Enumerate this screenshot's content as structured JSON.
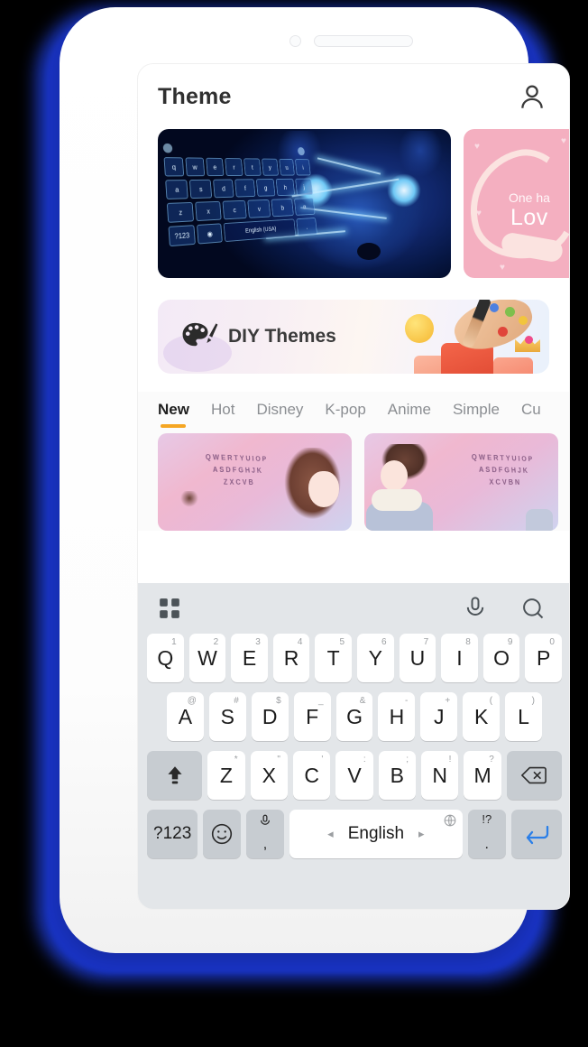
{
  "app": {
    "title": "Theme",
    "account_icon": "person-icon"
  },
  "featured": [
    {
      "name": "blue-wolf-theme",
      "keyboard_rows": [
        [
          "q",
          "w",
          "e",
          "r",
          "t",
          "y",
          "u",
          "i"
        ],
        [
          "a",
          "s",
          "d",
          "f",
          "g",
          "h",
          "j"
        ],
        [
          "z",
          "x",
          "c",
          "v",
          "b",
          "n"
        ]
      ],
      "space_label": "English (USA)",
      "num_label": "?123"
    },
    {
      "name": "one-hand-love-theme",
      "line1": "One ha",
      "line2": "Lov"
    }
  ],
  "diy_banner": {
    "label": "DIY Themes",
    "icon": "palette-brush-icon"
  },
  "tabs": [
    {
      "label": "New",
      "active": true
    },
    {
      "label": "Hot",
      "active": false
    },
    {
      "label": "Disney",
      "active": false
    },
    {
      "label": "K-pop",
      "active": false
    },
    {
      "label": "Anime",
      "active": false
    },
    {
      "label": "Simple",
      "active": false
    },
    {
      "label": "Cu",
      "active": false
    }
  ],
  "theme_grid": [
    {
      "name": "sakura-girl-theme",
      "rows": [
        "Q W E R T Y U I O P",
        "A S D F G H J K",
        "Z X C V B"
      ]
    },
    {
      "name": "sakura-boy-theme",
      "rows": [
        "Q W E R T Y U I O P",
        "A S D F G H J K",
        "X C V B N"
      ]
    }
  ],
  "keyboard": {
    "toolbar": {
      "grid_icon": "grid-icon",
      "mic_icon": "microphone-icon",
      "search_icon": "search-icon"
    },
    "row1": [
      {
        "key": "Q",
        "sup": "1"
      },
      {
        "key": "W",
        "sup": "2"
      },
      {
        "key": "E",
        "sup": "3"
      },
      {
        "key": "R",
        "sup": "4"
      },
      {
        "key": "T",
        "sup": "5"
      },
      {
        "key": "Y",
        "sup": "6"
      },
      {
        "key": "U",
        "sup": "7"
      },
      {
        "key": "I",
        "sup": "8"
      },
      {
        "key": "O",
        "sup": "9"
      },
      {
        "key": "P",
        "sup": "0"
      }
    ],
    "row2": [
      {
        "key": "A",
        "sup": "@"
      },
      {
        "key": "S",
        "sup": "#"
      },
      {
        "key": "D",
        "sup": "$"
      },
      {
        "key": "F",
        "sup": "_"
      },
      {
        "key": "G",
        "sup": "&"
      },
      {
        "key": "H",
        "sup": "-"
      },
      {
        "key": "J",
        "sup": "+"
      },
      {
        "key": "K",
        "sup": "("
      },
      {
        "key": "L",
        "sup": ")"
      }
    ],
    "row3": [
      {
        "key": "Z",
        "sup": "*"
      },
      {
        "key": "X",
        "sup": "\""
      },
      {
        "key": "C",
        "sup": "'"
      },
      {
        "key": "V",
        "sup": ":"
      },
      {
        "key": "B",
        "sup": ";"
      },
      {
        "key": "N",
        "sup": "!"
      },
      {
        "key": "M",
        "sup": "?"
      }
    ],
    "shift_icon": "shift-up-icon",
    "backspace_icon": "backspace-icon",
    "row4": {
      "num_label": "?123",
      "emoji_icon": "smiley-icon",
      "comma_key": ",",
      "comma_mic_icon": "microphone-icon",
      "space_label": "English",
      "space_left_arrow": "◂",
      "space_right_arrow": "▸",
      "globe_icon": "globe-icon",
      "period_key": ".",
      "period_sup": "!?",
      "enter_icon": "enter-arrow-icon"
    }
  },
  "colors": {
    "glow_blue": "#1a35bb",
    "accent_orange": "#f5a623",
    "keyboard_bg": "#e3e6e9",
    "key_white": "#ffffff",
    "key_gray": "#c7ccd1",
    "enter_blue": "#2b7fe8"
  }
}
